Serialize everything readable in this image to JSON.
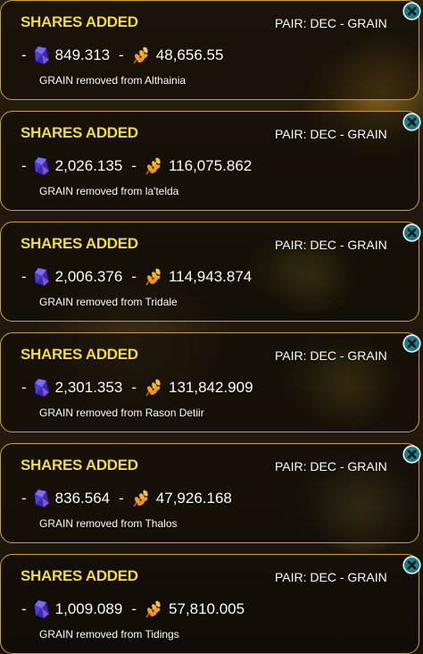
{
  "notifications": [
    {
      "title": "SHARES ADDED",
      "pair": "PAIR: DEC - GRAIN",
      "dec": "849.313",
      "grain": "48,656.55",
      "message": "GRAIN removed from Althainia"
    },
    {
      "title": "SHARES ADDED",
      "pair": "PAIR: DEC - GRAIN",
      "dec": "2,026.135",
      "grain": "116,075.862",
      "message": "GRAIN removed from la'telda"
    },
    {
      "title": "SHARES ADDED",
      "pair": "PAIR: DEC - GRAIN",
      "dec": "2,006.376",
      "grain": "114,943.874",
      "message": "GRAIN removed from Tridale"
    },
    {
      "title": "SHARES ADDED",
      "pair": "PAIR: DEC - GRAIN",
      "dec": "2,301.353",
      "grain": "131,842.909",
      "message": "GRAIN removed from Rason Detiir"
    },
    {
      "title": "SHARES ADDED",
      "pair": "PAIR: DEC - GRAIN",
      "dec": "836.564",
      "grain": "47,926.168",
      "message": "GRAIN removed from Thalos"
    },
    {
      "title": "SHARES ADDED",
      "pair": "PAIR: DEC - GRAIN",
      "dec": "1,009.089",
      "grain": "57,810.005",
      "message": "GRAIN removed from Tidings"
    }
  ],
  "separator": "-",
  "icons": {
    "dec": "dec-gem-icon",
    "grain": "grain-leaf-icon",
    "close": "close-icon"
  },
  "colors": {
    "title": "#f2dc3c",
    "border": "#caa034",
    "close_bg": "#1f7c86"
  }
}
